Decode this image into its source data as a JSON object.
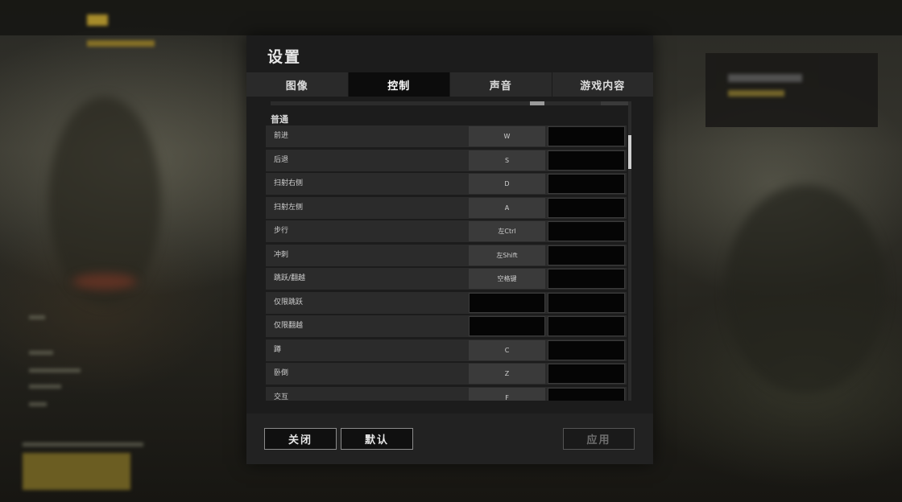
{
  "dialog": {
    "title": "设置",
    "tabs": [
      {
        "label": "图像",
        "active": false
      },
      {
        "label": "控制",
        "active": true
      },
      {
        "label": "声音",
        "active": false
      },
      {
        "label": "游戏内容",
        "active": false
      }
    ],
    "section_title": "普通",
    "bindings": [
      {
        "action": "前进",
        "key": "W"
      },
      {
        "action": "后退",
        "key": "S"
      },
      {
        "action": "扫射右侧",
        "key": "D"
      },
      {
        "action": "扫射左侧",
        "key": "A"
      },
      {
        "action": "步行",
        "key": "左Ctrl"
      },
      {
        "action": "冲刺",
        "key": "左Shift"
      },
      {
        "action": "跳跃/翻越",
        "key": "空格键"
      },
      {
        "action": "仅限跳跃",
        "key": ""
      },
      {
        "action": "仅限翻越",
        "key": ""
      },
      {
        "action": "蹲",
        "key": "C"
      },
      {
        "action": "卧倒",
        "key": "Z"
      },
      {
        "action": "交互",
        "key": "F"
      }
    ],
    "buttons": {
      "close": "关闭",
      "default": "默认",
      "apply": "应用"
    }
  },
  "colors": {
    "dialog_bg": "#1c1c1c",
    "active_tab": "#0c0c0c",
    "row_bg": "#2b2b2b",
    "key_bg": "#3a3a3a"
  }
}
